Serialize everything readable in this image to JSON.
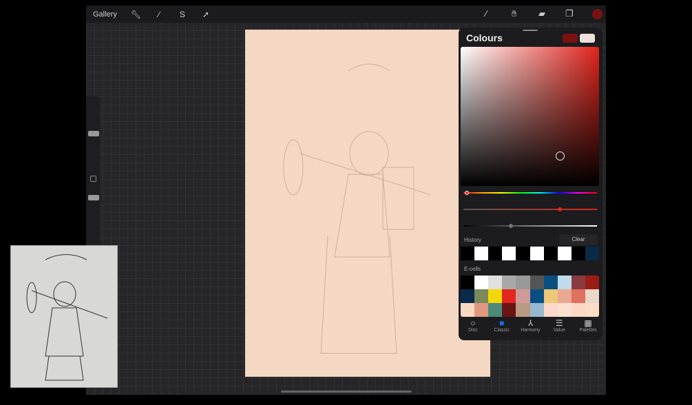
{
  "topbar": {
    "gallery": "Gallery",
    "left_tools": [
      "wrench-icon",
      "magic-wand-icon",
      "selection-icon",
      "transform-icon"
    ],
    "right_tools": [
      "brush-icon",
      "smudge-icon",
      "eraser-icon",
      "layers-icon"
    ],
    "current_color": "#7a1212"
  },
  "colours": {
    "title": "Colours",
    "current": "#7a1212",
    "previous": "#ece0dc",
    "hue": "#e0241c",
    "saturation_pct": 72,
    "brightness_pct": 35,
    "history_label": "History",
    "clear_label": "Clear",
    "history": [
      "#000000",
      "#ffffff",
      "#000000",
      "#ffffff",
      "#000000",
      "#ffffff",
      "#000000",
      "#ffffff",
      "#000000",
      "#0a2a48"
    ],
    "ecells_label": "E-cells",
    "ecells": [
      "#000000",
      "#ffffff",
      "#e0e0e0",
      "#a8a8a8",
      "#999999",
      "#555555",
      "#0a4f82",
      "#c0dcec",
      "#8a3a40",
      "#9a1c14",
      "#0a2a4a",
      "#7a8a5a",
      "#f2d80a",
      "#e0281c",
      "#d09a98",
      "#0a4f82",
      "#ecc878",
      "#eaa890",
      "#e07060",
      "#ecd8c8",
      "#f8d8c0",
      "#e09880",
      "#4a8a7a",
      "#6a1414",
      "#b89a80",
      "#98b8d0",
      "#fcd8cc",
      "#fce0d0",
      "#fcd8c4",
      "#fcdcc4"
    ],
    "tabs": [
      {
        "label": "Disc",
        "icon": "disc-icon"
      },
      {
        "label": "Classic",
        "icon": "classic-square-icon",
        "active": true
      },
      {
        "label": "Harmony",
        "icon": "harmony-icon"
      },
      {
        "label": "Value",
        "icon": "value-sliders-icon"
      },
      {
        "label": "Palettes",
        "icon": "palettes-grid-icon"
      }
    ]
  }
}
